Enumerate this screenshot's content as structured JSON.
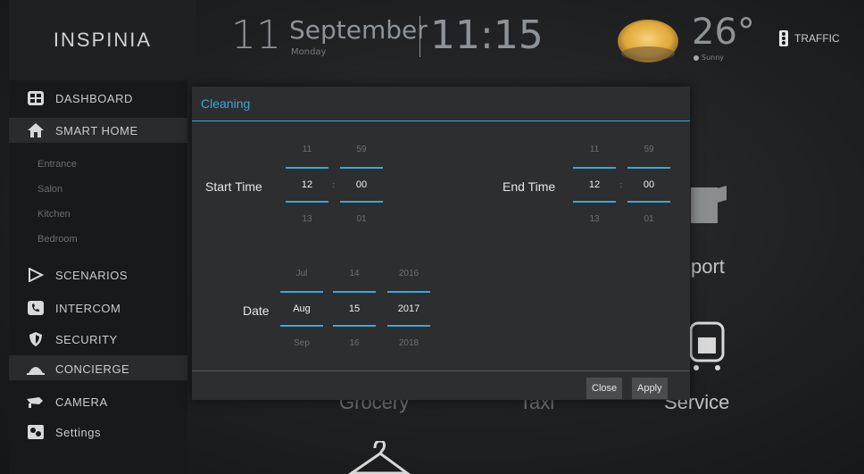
{
  "brand": {
    "name": "INSPINIA"
  },
  "header": {
    "day": "11",
    "month": "September",
    "weekday": "Monday",
    "time": "11:15",
    "temperature": "26°",
    "condition": "Sunny",
    "traffic": "TRAFFIC"
  },
  "sidebar": {
    "items": [
      {
        "label": "DASHBOARD",
        "icon": "dashboard-icon"
      },
      {
        "label": "SMART HOME",
        "icon": "home-icon"
      },
      {
        "label": "SCENARIOS",
        "icon": "play-icon"
      },
      {
        "label": "INTERCOM",
        "icon": "phone-icon"
      },
      {
        "label": "SECURITY",
        "icon": "shield-icon"
      },
      {
        "label": "CONCIERGE",
        "icon": "concierge-icon"
      },
      {
        "label": "CAMERA",
        "icon": "camera-icon"
      },
      {
        "label": "Settings",
        "icon": "settings-icon"
      }
    ],
    "rooms": [
      "Entrance",
      "Salon",
      "Kitchen",
      "Bedroom"
    ]
  },
  "background": {
    "tile_labels": [
      "port",
      "Grocery",
      "Taxi",
      "Service"
    ]
  },
  "modal": {
    "title": "Cleaning",
    "start_label": "Start Time",
    "end_label": "End Time",
    "date_label": "Date",
    "start": {
      "hour": {
        "prev": "11",
        "cur": "12",
        "next": "13"
      },
      "minute": {
        "prev": "59",
        "cur": "00",
        "next": "01"
      }
    },
    "end": {
      "hour": {
        "prev": "11",
        "cur": "12",
        "next": "13"
      },
      "minute": {
        "prev": "59",
        "cur": "00",
        "next": "01"
      }
    },
    "date": {
      "month": {
        "prev": "Jul",
        "cur": "Aug",
        "next": "Sep"
      },
      "day": {
        "prev": "14",
        "cur": "15",
        "next": "16"
      },
      "year": {
        "prev": "2016",
        "cur": "2017",
        "next": "2018"
      }
    },
    "separator": ":",
    "close_label": "Close",
    "apply_label": "Apply"
  },
  "colors": {
    "accent": "#3aa7d6",
    "panel": "#2d2e30"
  }
}
